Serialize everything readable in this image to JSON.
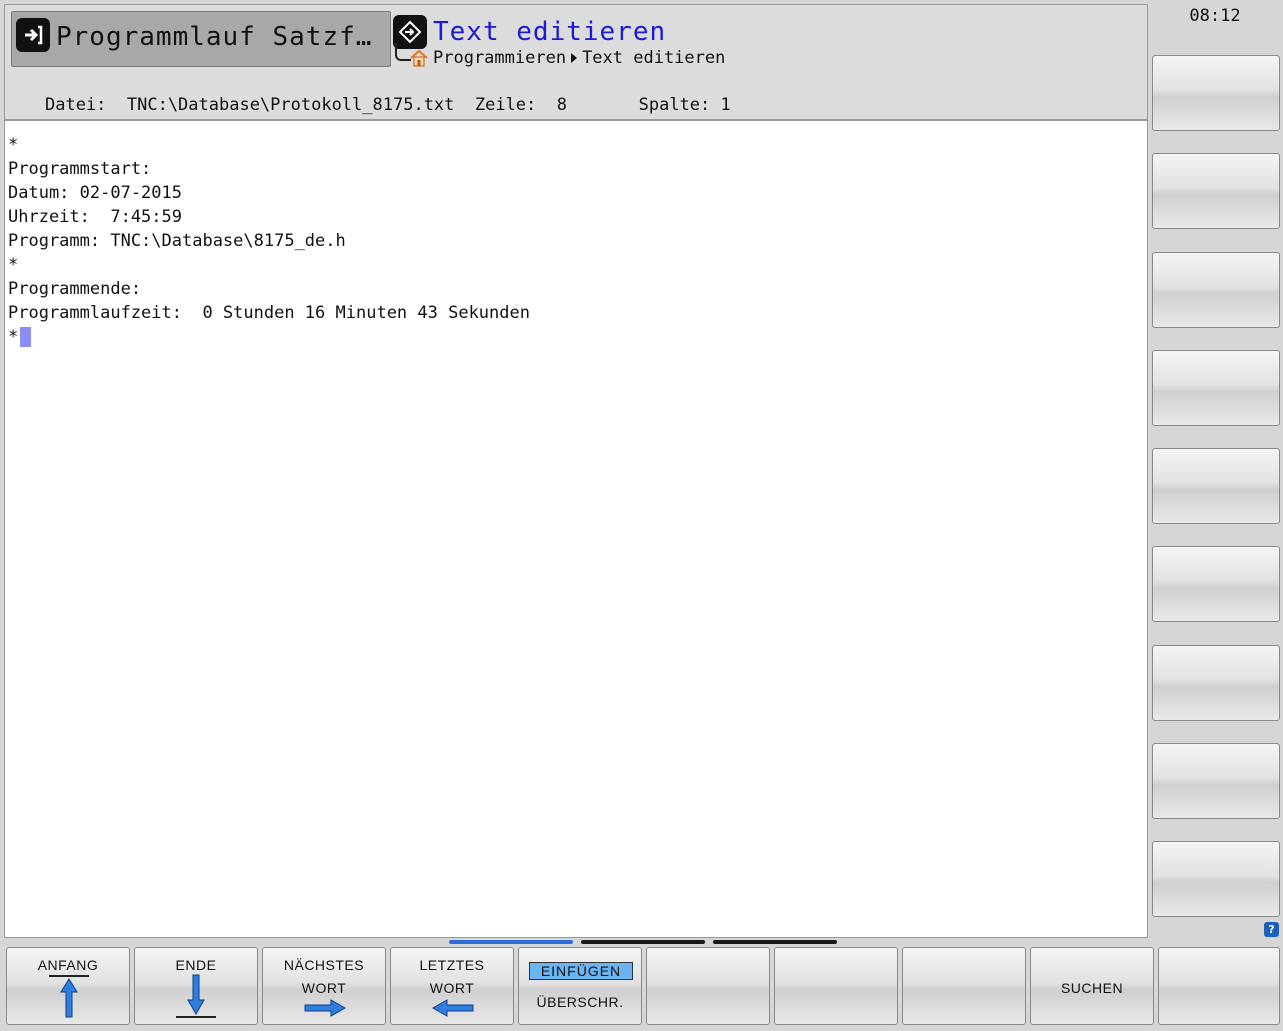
{
  "header": {
    "inactive_mode": "Programmlauf Satzf…",
    "active_mode": "Text editieren",
    "breadcrumb": [
      "Programmieren",
      "Text editieren"
    ],
    "file_info": "Datei:  TNC:\\Database\\Protokoll_8175.txt  Zeile:  8       Spalte: 1"
  },
  "clock": "08:12",
  "editor": {
    "lines": [
      "*",
      "Programmstart:",
      "Datum: 02-07-2015",
      "Uhrzeit:  7:45:59",
      "Programm: TNC:\\Database\\8175_de.h",
      "*",
      "Programmende:",
      "Programmlaufzeit:  0 Stunden 16 Minuten 43 Sekunden",
      "*"
    ]
  },
  "softkeys": {
    "anfang": "ANFANG",
    "ende": "ENDE",
    "naechstes_l1": "NÄCHSTES",
    "naechstes_l2": "WORT",
    "letztes_l1": "LETZTES",
    "letztes_l2": "WORT",
    "einfuegen": "EINFÜGEN",
    "ueberschr": "ÜBERSCHR.",
    "suchen": "SUCHEN"
  },
  "colors": {
    "accent_title": "#1a1ad8",
    "toggle_active": "#6ab4f2",
    "cursor": "#8d8df5",
    "arrow_blue": "#2f7fe0"
  }
}
